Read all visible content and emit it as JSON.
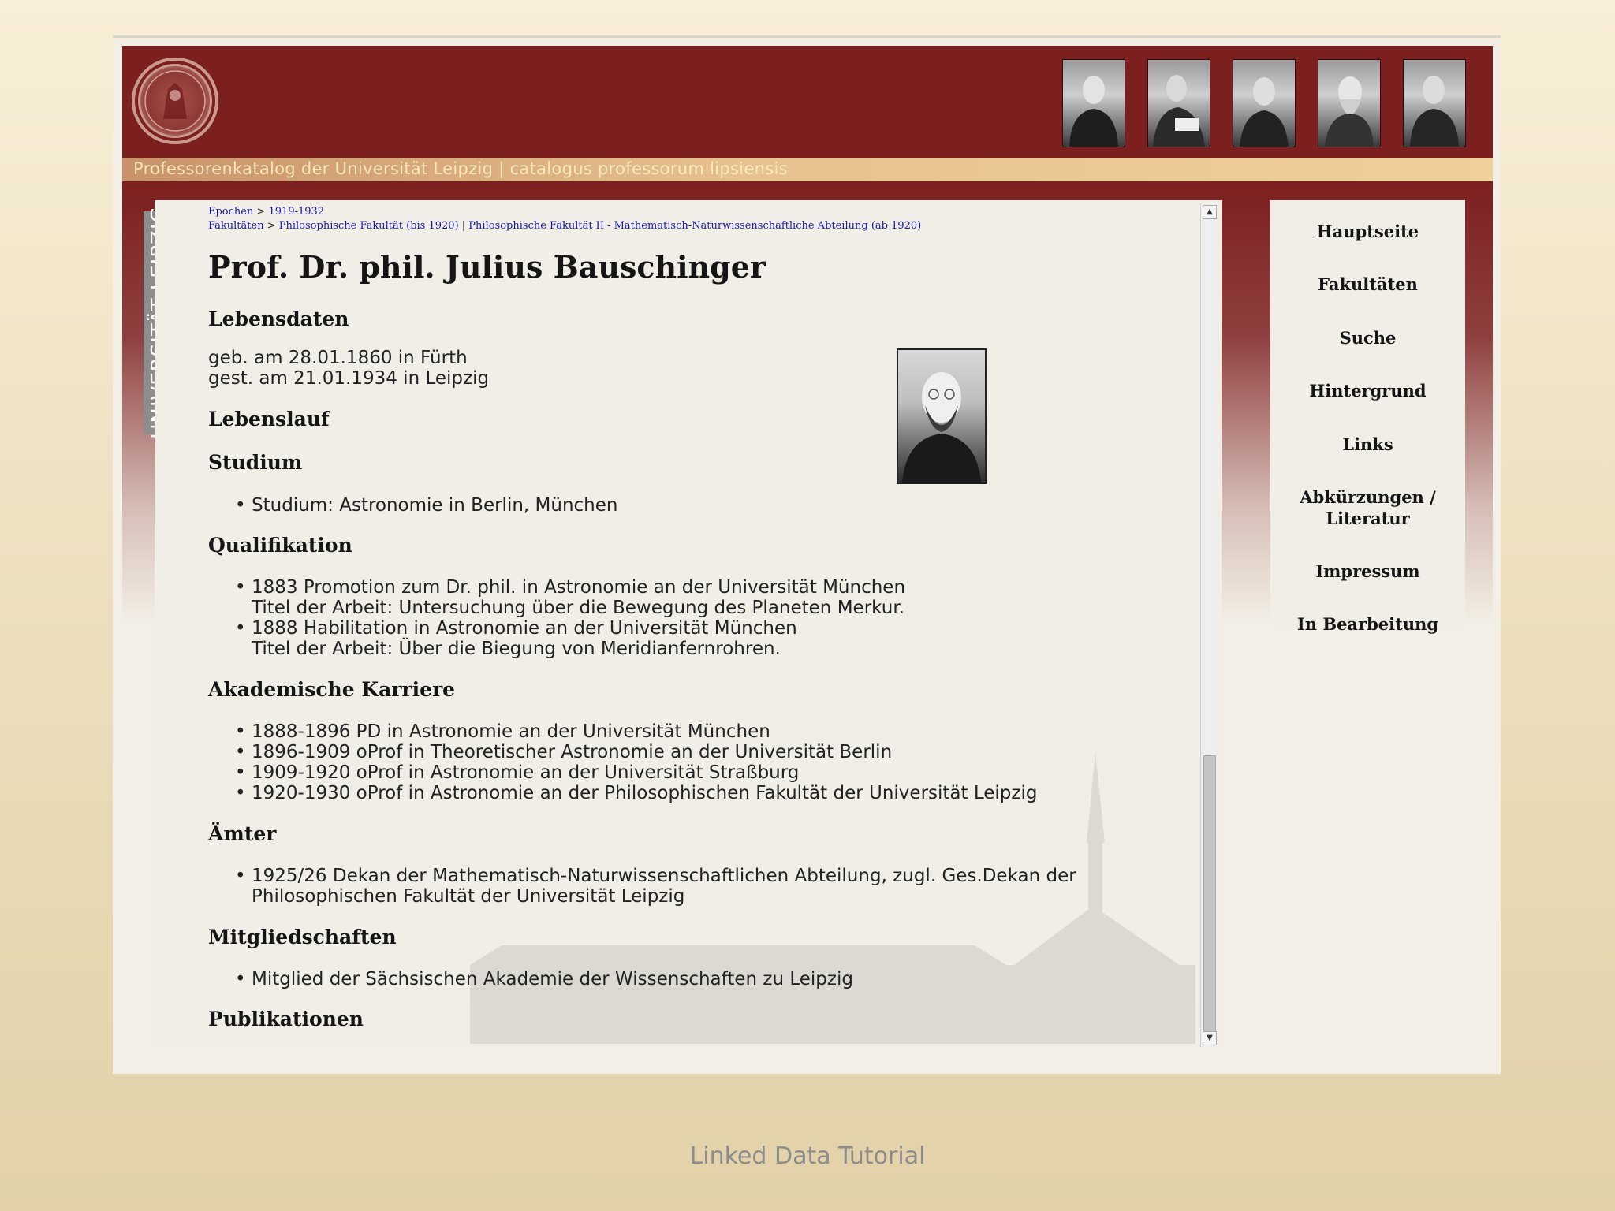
{
  "header": {
    "subtitle": "Professorenkatalog der Universität Leipzig | catalogus professorum lipsiensis",
    "seal_icon": "university-seal-icon",
    "colors": {
      "maroon": "#7c1f1f",
      "gold_bar": "#e7c18f"
    }
  },
  "sidebar_label": "UNIVERSITÄT LEIPZIG",
  "breadcrumb": {
    "line1": [
      "Epochen",
      "1919-1932"
    ],
    "line2": [
      "Fakultäten",
      "Philosophische Fakultät (bis 1920)",
      "Philosophische Fakultät II - Mathematisch-Naturwissenschaftliche Abteilung (ab 1920)"
    ]
  },
  "person": {
    "name": "Prof. Dr. phil. Julius Bauschinger"
  },
  "sections": {
    "lebensdaten": {
      "heading": "Lebensdaten",
      "born": "geb. am 28.01.1860 in Fürth",
      "died": "gest. am 21.01.1934 in Leipzig"
    },
    "lebenslauf": {
      "heading": "Lebenslauf"
    },
    "studium": {
      "heading": "Studium",
      "items": [
        "Studium: Astronomie in Berlin, München"
      ]
    },
    "qualifikation": {
      "heading": "Qualifikation",
      "items": [
        {
          "text": "1883 Promotion zum Dr. phil. in Astronomie an der Universität München",
          "sub": "Titel der Arbeit: Untersuchung über die Bewegung des Planeten Merkur."
        },
        {
          "text": "1888 Habilitation in Astronomie an der Universität München",
          "sub": "Titel der Arbeit: Über die Biegung von Meridianfernrohren."
        }
      ]
    },
    "karriere": {
      "heading": "Akademische Karriere",
      "items": [
        "1888-1896 PD in Astronomie an der Universität München",
        "1896-1909 oProf in Theoretischer Astronomie an der Universität Berlin",
        "1909-1920 oProf in Astronomie an der Universität Straßburg",
        "1920-1930 oProf in Astronomie an der Philosophischen Fakultät der Universität Leipzig"
      ]
    },
    "aemter": {
      "heading": "Ämter",
      "line1": "1925/26 Dekan der Mathematisch-Naturwissenschaftlichen Abteilung, zugl. Ges.Dekan der",
      "line2": "Philosophischen Fakultät der Universität Leipzig"
    },
    "mitglied": {
      "heading": "Mitgliedschaften",
      "items": [
        "Mitglied der Sächsischen Akademie der Wissenschaften zu Leipzig"
      ]
    },
    "publikationen": {
      "heading": "Publikationen"
    }
  },
  "nav": {
    "items": [
      "Hauptseite",
      "Fakultäten",
      "Suche",
      "Hintergrund",
      "Links",
      "Abkürzungen /",
      "Literatur",
      "Impressum",
      "In Bearbeitung"
    ]
  },
  "footer": "Linked Data Tutorial"
}
